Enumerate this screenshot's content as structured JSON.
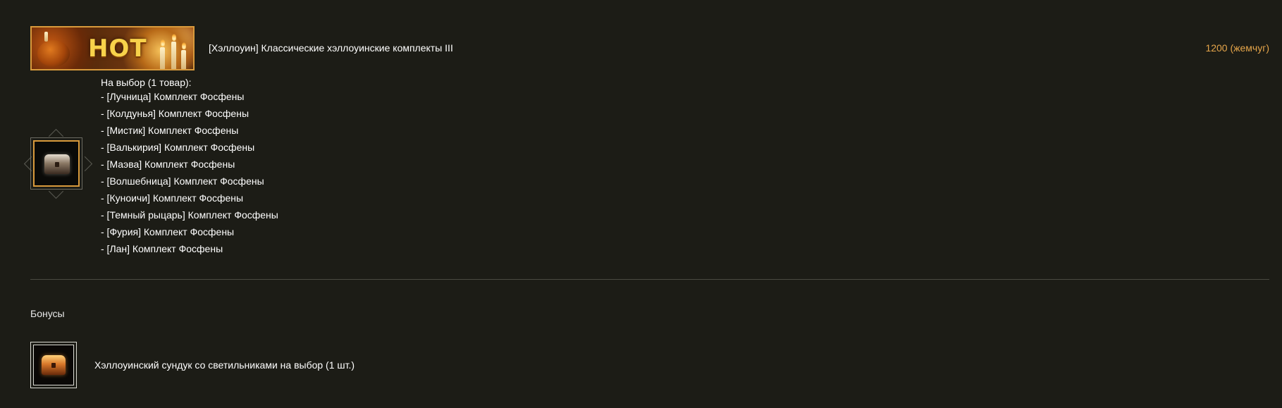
{
  "header": {
    "banner_text": "HOT",
    "title": "[Хэллоуин] Классические хэллоуинские комплекты III",
    "price": "1200 (жемчуг)"
  },
  "choice": {
    "heading": "На выбор (1 товар):",
    "items": [
      "- [Лучница] Комплект Фосфены",
      "- [Колдунья] Комплект Фосфены",
      "- [Мистик] Комплект Фосфены",
      "- [Валькирия] Комплект Фосфены",
      "- [Маэва] Комплект Фосфены",
      "- [Волшебница] Комплект Фосфены",
      "- [Куноичи] Комплект Фосфены",
      "- [Темный рыцарь] Комплект Фосфены",
      "- [Фурия] Комплект Фосфены",
      "- [Лан] Комплект Фосфены"
    ]
  },
  "bonuses": {
    "heading": "Бонусы",
    "item_label": "Хэллоуинский сундук со светильниками на выбор (1 шт.)"
  },
  "colors": {
    "background": "#1c1c16",
    "price": "#e5a54a",
    "frame_gold": "#d89a3c"
  }
}
